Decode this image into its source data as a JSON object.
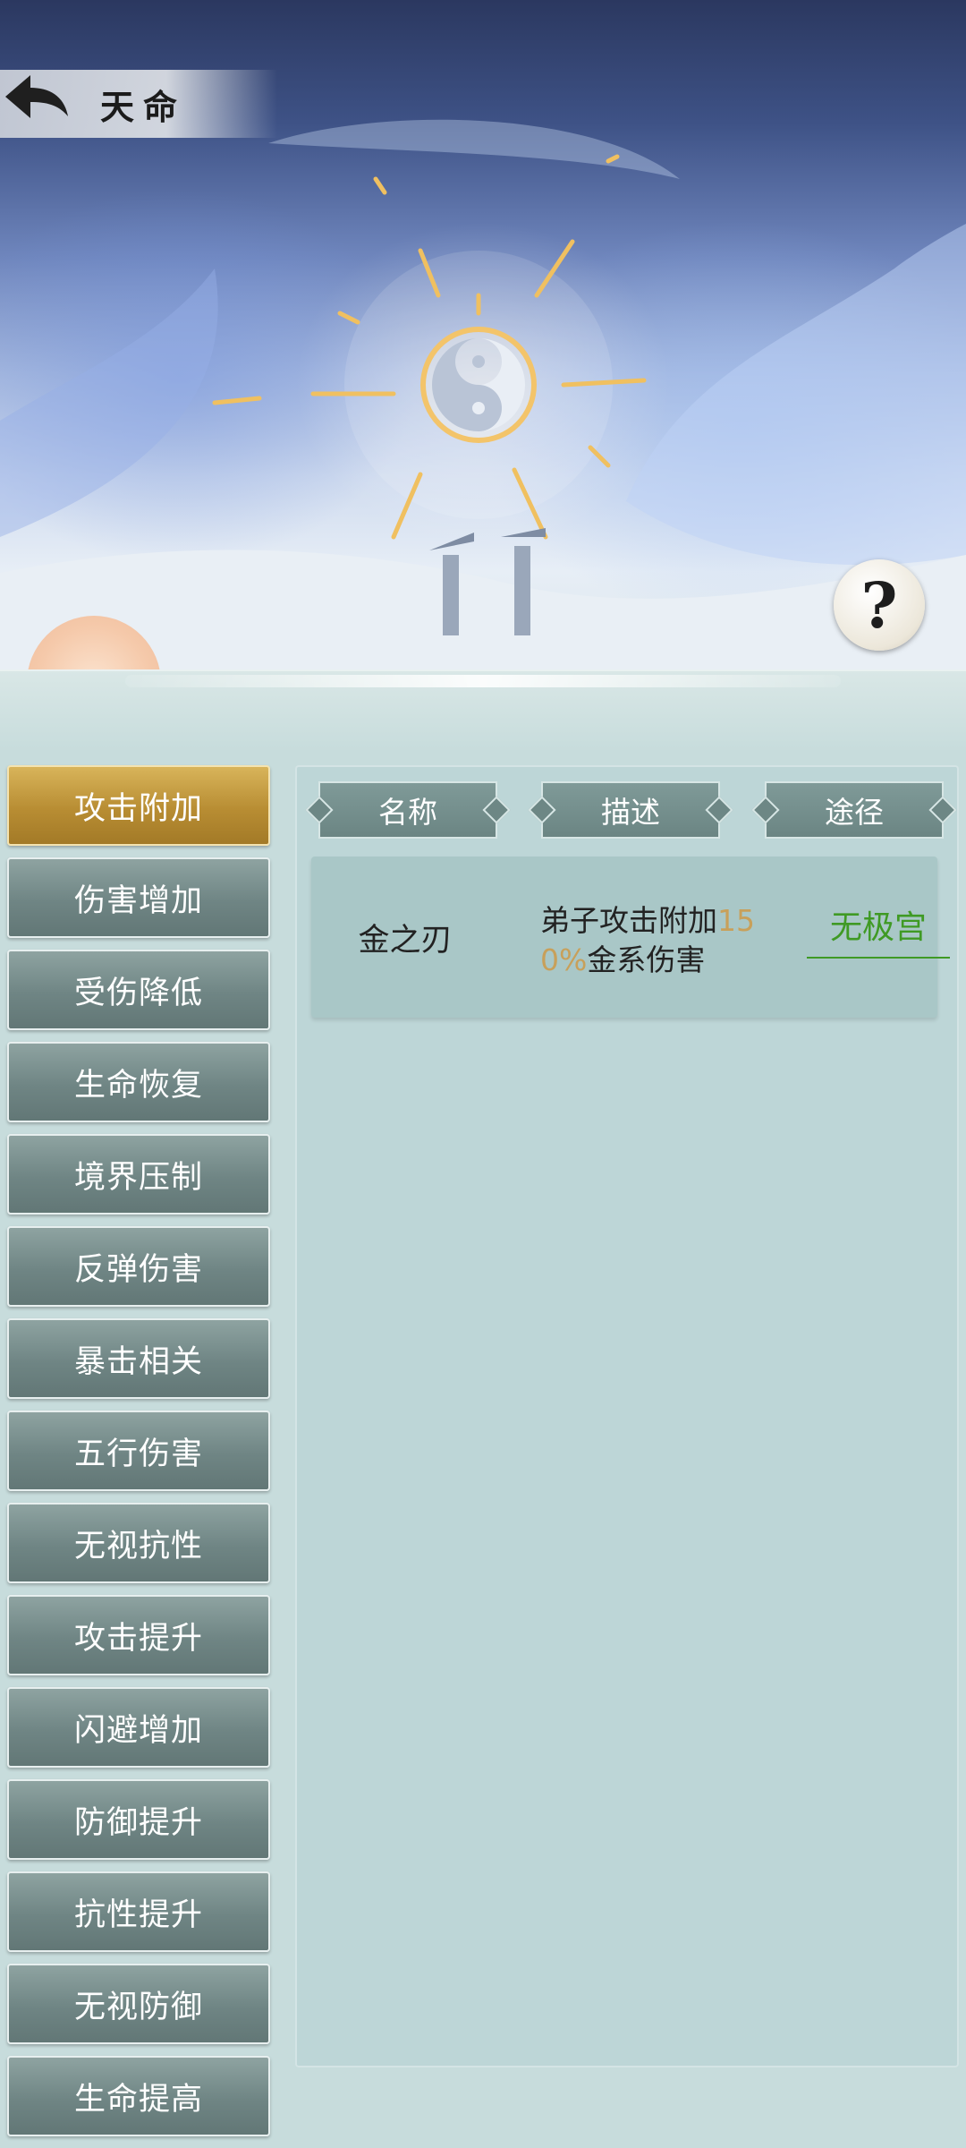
{
  "header": {
    "title": "天命",
    "help_label": "?"
  },
  "sidebar": {
    "items": [
      {
        "label": "攻击附加",
        "active": true
      },
      {
        "label": "伤害增加",
        "active": false
      },
      {
        "label": "受伤降低",
        "active": false
      },
      {
        "label": "生命恢复",
        "active": false
      },
      {
        "label": "境界压制",
        "active": false
      },
      {
        "label": "反弹伤害",
        "active": false
      },
      {
        "label": "暴击相关",
        "active": false
      },
      {
        "label": "五行伤害",
        "active": false
      },
      {
        "label": "无视抗性",
        "active": false
      },
      {
        "label": "攻击提升",
        "active": false
      },
      {
        "label": "闪避增加",
        "active": false
      },
      {
        "label": "防御提升",
        "active": false
      },
      {
        "label": "抗性提升",
        "active": false
      },
      {
        "label": "无视防御",
        "active": false
      },
      {
        "label": "生命提高",
        "active": false
      }
    ]
  },
  "table": {
    "columns": [
      "名称",
      "描述",
      "途径"
    ],
    "rows": [
      {
        "name": "金之刃",
        "desc_before": "弟子攻击附加",
        "desc_highlight": "150%",
        "desc_after": "金系伤害",
        "path": "无极宫"
      }
    ]
  },
  "colors": {
    "active_tab": "#b88d33",
    "tab": "#6f8584",
    "highlight_value": "#c8a05a",
    "path_link": "#3f9a24"
  }
}
